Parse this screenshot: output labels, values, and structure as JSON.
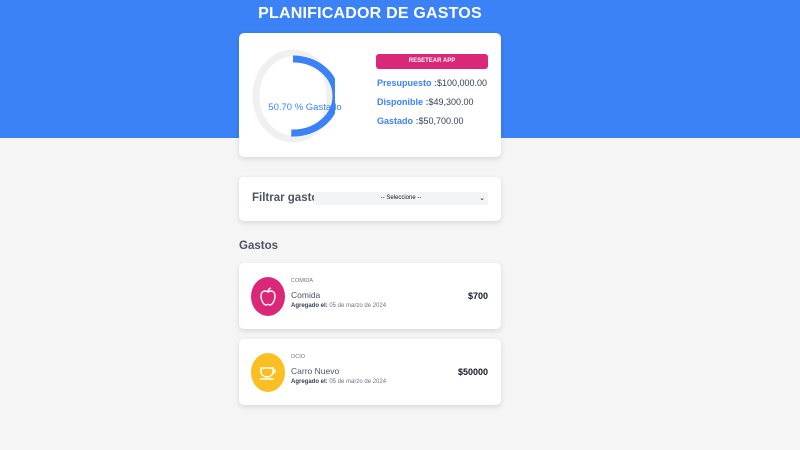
{
  "header": {
    "title": "PLANIFICADOR DE GASTOS"
  },
  "budget": {
    "percent_spent": 50.7,
    "spent_label": "50.70 % Gastado",
    "reset_label": "RESETEAR APP",
    "presupuesto_label": "Presupuesto :",
    "presupuesto_value": "$100,000.00",
    "disponible_label": "Disponible :",
    "disponible_value": "$49,300.00",
    "gastado_label": "Gastado :",
    "gastado_value": "$50,700.00"
  },
  "filter": {
    "label": "Filtrar gastos",
    "selected": "-- Seleccione --"
  },
  "expenses": {
    "title": "Gastos",
    "items": [
      {
        "category": "COMIDA",
        "name": "Comida",
        "date_label": "Agregado el:",
        "date": "05 de marzo de 2024",
        "amount": "$700",
        "icon": "apple-icon",
        "color": "#db2777"
      },
      {
        "category": "OCIO",
        "name": "Carro Nuevo",
        "date_label": "Agregado el:",
        "date": "05 de marzo de 2024",
        "amount": "$50000",
        "icon": "cup-icon",
        "color": "#fbbf24"
      }
    ]
  },
  "colors": {
    "primary": "#3b82f6",
    "accent": "#db2777",
    "background": "#f5f5f5"
  }
}
